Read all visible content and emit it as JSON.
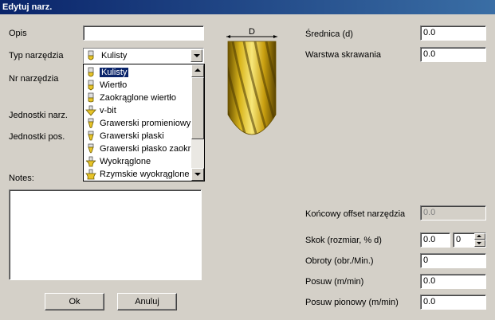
{
  "window": {
    "title": "Edytuj narz."
  },
  "form": {
    "opis": {
      "label": "Opis",
      "value": ""
    },
    "typ": {
      "label": "Typ narzędzia",
      "selected": "Kulisty"
    },
    "nr": {
      "label": "Nr narzędzia"
    },
    "jednostki_narz": {
      "label": "Jednostki narz."
    },
    "jednostki_pos": {
      "label": "Jednostki pos."
    },
    "notes": {
      "label": "Notes:",
      "value": ""
    },
    "srednica": {
      "label": "Średnica (d)",
      "value": "0.0"
    },
    "warstwa": {
      "label": "Warstwa skrawania",
      "value": "0.0"
    },
    "koncowy": {
      "label": "Końcowy offset narzędzia",
      "value": "0.0"
    },
    "skok": {
      "label": "Skok (rozmiar, % d)",
      "value1": "0.0",
      "value2": "0"
    },
    "obroty": {
      "label": "Obroty (obr./Min.)",
      "value": "0"
    },
    "posuw": {
      "label": "Posuw (m/min)",
      "value": "0.0"
    },
    "posuw_pion": {
      "label": "Posuw pionowy (m/min)",
      "value": "0.0"
    }
  },
  "dropdown_items": [
    {
      "label": "Kulisty",
      "icon": "ball-mill-icon"
    },
    {
      "label": "Wiertło",
      "icon": "drill-icon"
    },
    {
      "label": "Zaokrąglone wiertło",
      "icon": "rounded-drill-icon"
    },
    {
      "label": "v-bit",
      "icon": "v-bit-icon"
    },
    {
      "label": "Grawerski promieniowy",
      "icon": "radial-engraver-icon"
    },
    {
      "label": "Grawerski płaski",
      "icon": "flat-engraver-icon"
    },
    {
      "label": "Grawerski płasko zaokr",
      "icon": "flat-rounded-engraver-icon"
    },
    {
      "label": "Wyokrąglone",
      "icon": "round-over-icon"
    },
    {
      "label": "Rzymskie wyokrąglone",
      "icon": "roman-ogee-icon"
    }
  ],
  "preview": {
    "dimension_label": "D"
  },
  "buttons": {
    "ok": "Ok",
    "cancel": "Anuluj"
  }
}
